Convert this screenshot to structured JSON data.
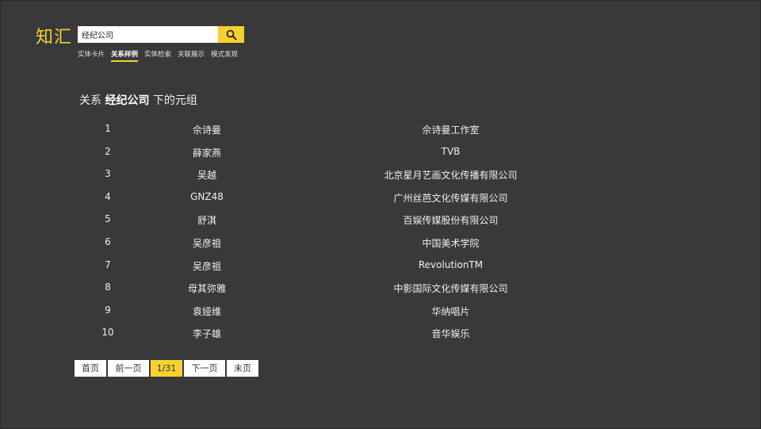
{
  "app": {
    "logo": "知汇"
  },
  "search": {
    "value": "经纪公司",
    "button_icon": "search-icon"
  },
  "tabs": [
    {
      "label": "实体卡片",
      "active": false
    },
    {
      "label": "关系样例",
      "active": true
    },
    {
      "label": "实体检索",
      "active": false
    },
    {
      "label": "关联展示",
      "active": false
    },
    {
      "label": "模式发现",
      "active": false
    }
  ],
  "heading": {
    "prefix": "关系 ",
    "relation": "经纪公司",
    "suffix": " 下的元组"
  },
  "rows": [
    {
      "index": "1",
      "entity": "佘诗曼",
      "value": "佘诗曼工作室"
    },
    {
      "index": "2",
      "entity": "薛家燕",
      "value": "TVB"
    },
    {
      "index": "3",
      "entity": "吴越",
      "value": "北京星月艺画文化传播有限公司"
    },
    {
      "index": "4",
      "entity": "GNZ48",
      "value": "广州丝芭文化传媒有限公司"
    },
    {
      "index": "5",
      "entity": "舒淇",
      "value": "百娱传媒股份有限公司"
    },
    {
      "index": "6",
      "entity": "吴彦祖",
      "value": "中国美术学院"
    },
    {
      "index": "7",
      "entity": "吴彦祖",
      "value": "RevolutionTM"
    },
    {
      "index": "8",
      "entity": "母其弥雅",
      "value": "中影国际文化传媒有限公司"
    },
    {
      "index": "9",
      "entity": "袁娅维",
      "value": "华纳唱片"
    },
    {
      "index": "10",
      "entity": "李子雄",
      "value": "音华娱乐"
    }
  ],
  "pagination": {
    "first": "首页",
    "prev": "前一页",
    "current": "1/31",
    "next": "下一页",
    "last": "末页"
  },
  "colors": {
    "background": "#393939",
    "accent": "#f5d130"
  }
}
